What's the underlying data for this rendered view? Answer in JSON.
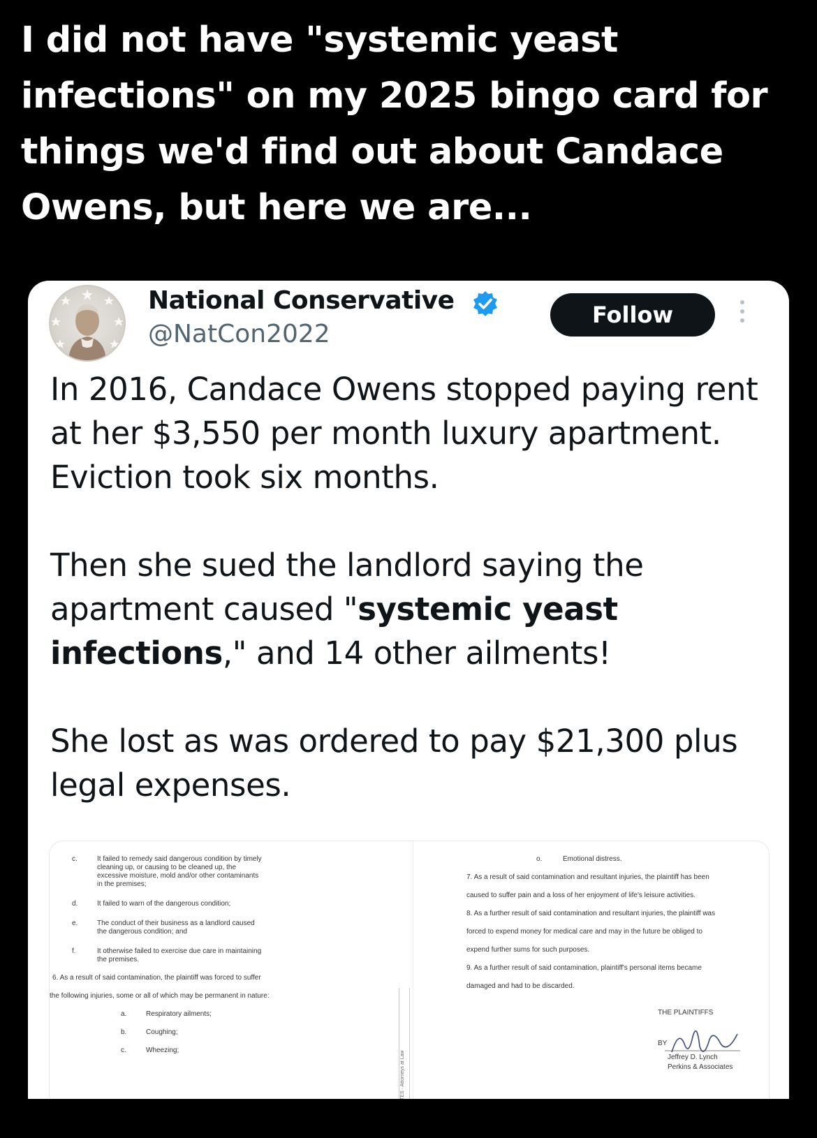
{
  "caption": {
    "line1": "I did not have \"systemic yeast",
    "line2": "infections\" on my 2025 bingo card for",
    "line3": "things we'd find out about Candace",
    "line4": "Owens, but here we are..."
  },
  "tweet": {
    "author_name": "National Conservative",
    "author_handle": "@NatCon2022",
    "follow_label": "Follow",
    "verified_color": "#1d9bf0",
    "p1": "In 2016, Candace Owens stopped paying rent at her $3,550 per month luxury apartment. Eviction took six months.",
    "p2_a": "Then she sued the landlord saying the apartment caused \"",
    "p2_bold": "systemic yeast infections",
    "p2_b": ",\" and 14 other ailments!",
    "p3": "She lost as was ordered to pay $21,300 plus legal expenses."
  },
  "document": {
    "left": {
      "c_letter": "c.",
      "c_1": "It failed to remedy said dangerous condition by timely",
      "c_2": "cleaning up, or causing to be cleaned up, the",
      "c_3": "excessive moisture, mold and/or other contaminants",
      "c_4": "in the premises;",
      "d_letter": "d.",
      "d_1": "It failed to warn of the dangerous condition;",
      "e_letter": "e.",
      "e_1": "The conduct of their business as a landlord caused",
      "e_2": "the dangerous condition; and",
      "f_letter": "f.",
      "f_1": "It otherwise failed to exercise due care in maintaining",
      "f_2": "the premises.",
      "p6_1": "6. As a result of said contamination, the plaintiff was forced to suffer",
      "p6_2": "the following injuries, some or all of which may be permanent in nature:",
      "a_letter": "a.",
      "a_1": "Respiratory ailments;",
      "b_letter": "b.",
      "b_1": "Coughing;",
      "cc_letter": "c.",
      "cc_1": "Wheezing;"
    },
    "margin_text": "TES · Attorneys at Law",
    "right": {
      "o_letter": "o.",
      "o_1": "Emotional distress.",
      "p7_1": "7. As a result of said contamination and resultant injuries, the plaintiff has been",
      "p7_2": "caused to suffer pain and a loss of her enjoyment of life's leisure activities.",
      "p8_1": "8. As a further result of said contamination and resultant injuries, the plaintiff was",
      "p8_2": "forced to expend money for medical care and may in the future be obliged to",
      "p8_3": "expend further sums for such purposes.",
      "p9_1": "9. As a further result of said contamination, plaintiff's personal items became",
      "p9_2": "damaged and had to be discarded.",
      "plaintiffs": "THE PLAINTIFFS",
      "by": "BY",
      "signer": "Jeffrey D. Lynch",
      "firm": "Perkins & Associates"
    }
  }
}
